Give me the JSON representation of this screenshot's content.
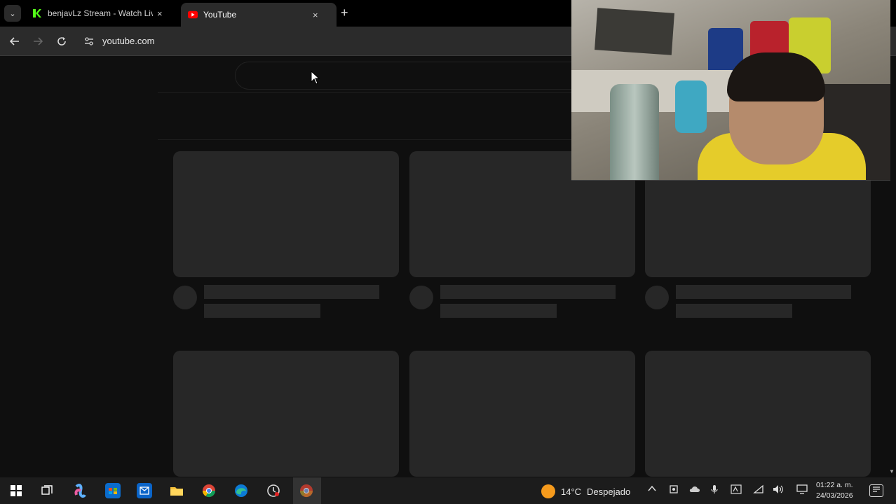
{
  "browser": {
    "tabs": [
      {
        "title": "benjavLz Stream - Watch Live o",
        "favicon": "kick-icon",
        "active": false
      },
      {
        "title": "YouTube",
        "favicon": "youtube-icon",
        "active": true
      }
    ],
    "new_tab_label": "+",
    "tab_menu_label": "⌄",
    "close_label": "×",
    "address": "youtube.com"
  },
  "taskbar": {
    "weather_temp": "14°C",
    "weather_desc": "Despejado",
    "time": "01:22 a. m.",
    "date": "24/03/2026",
    "apps": [
      "windows-start-icon",
      "task-view-icon",
      "copilot-icon",
      "microsoft-store-icon",
      "outlook-icon",
      "file-explorer-icon",
      "chrome-icon",
      "edge-icon",
      "clock-app-icon",
      "chrome-profile-icon"
    ]
  },
  "colors": {
    "page_bg": "#0f0f0f",
    "skeleton": "#272727",
    "toolbar": "#2b2b2b",
    "accent_kick": "#53fc18",
    "accent_youtube": "#ff0000"
  }
}
